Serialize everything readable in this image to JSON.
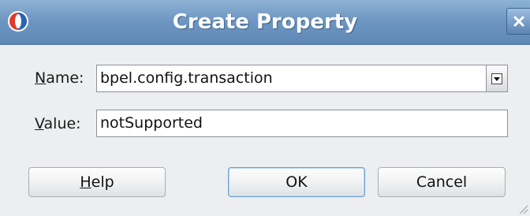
{
  "window": {
    "title": "Create Property"
  },
  "form": {
    "name_label_mnemonic": "N",
    "name_label_rest": "ame:",
    "name_value": "bpel.config.transaction",
    "value_label_mnemonic": "V",
    "value_label_rest": "alue:",
    "value_value": "notSupported"
  },
  "buttons": {
    "help_mnemonic": "H",
    "help_rest": "elp",
    "ok": "OK",
    "cancel": "Cancel"
  },
  "icons": {
    "app": "oracle-jdeveloper-icon",
    "close": "close-icon",
    "dropdown": "chevron-down-icon",
    "resize": "resize-grip-icon"
  },
  "colors": {
    "titlebar": "#6f97c2",
    "dialog_bg": "#eceeef",
    "ok_border": "#6d9ed6"
  }
}
